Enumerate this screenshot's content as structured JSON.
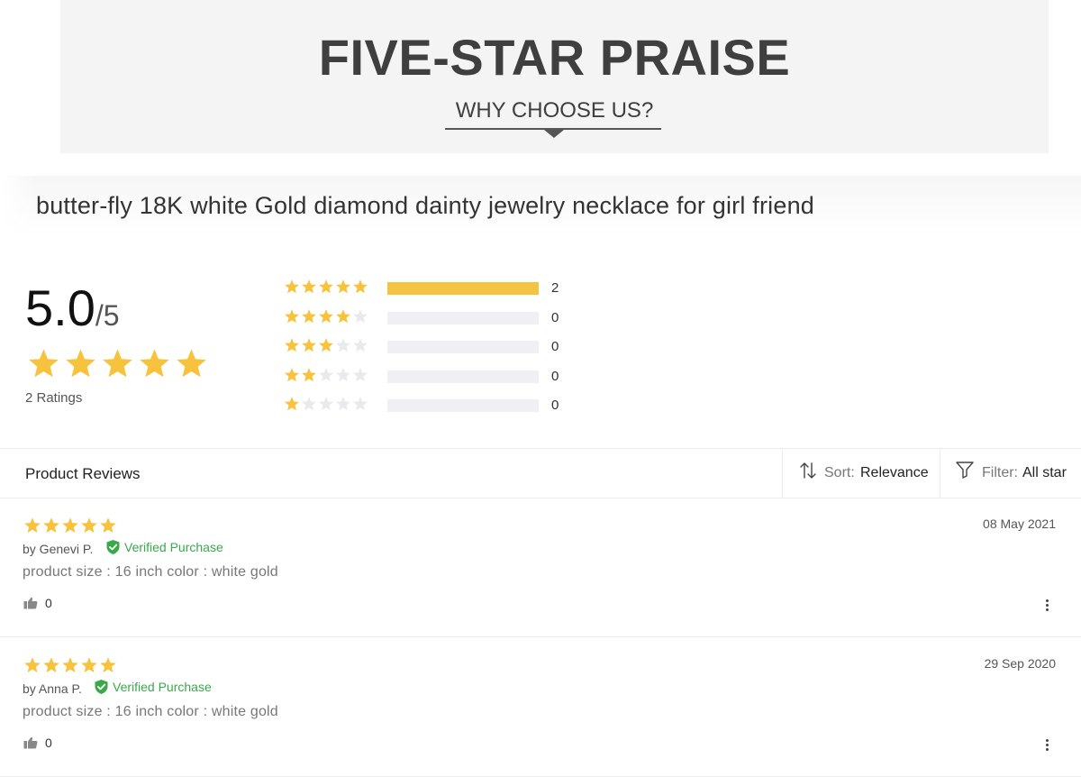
{
  "banner": {
    "title": "FIVE-STAR PRAISE",
    "subtitle": "WHY CHOOSE US?"
  },
  "product": {
    "title": "butter-fly 18K white Gold diamond dainty jewelry necklace for girl friend"
  },
  "summary": {
    "score": "5.0",
    "separator": "/",
    "out_of": "5",
    "stars": 5,
    "ratings_label": "2 Ratings",
    "histogram": [
      {
        "stars": 5,
        "count": "2",
        "fraction": 1.0
      },
      {
        "stars": 4,
        "count": "0",
        "fraction": 0
      },
      {
        "stars": 3,
        "count": "0",
        "fraction": 0
      },
      {
        "stars": 2,
        "count": "0",
        "fraction": 0
      },
      {
        "stars": 1,
        "count": "0",
        "fraction": 0
      }
    ]
  },
  "reviews_header": {
    "title": "Product Reviews",
    "sort_label": "Sort:",
    "sort_value": "Relevance",
    "filter_label": "Filter:",
    "filter_value": "All star"
  },
  "reviews": [
    {
      "stars": 5,
      "author": "by Genevi P.",
      "verified": "Verified Purchase",
      "body": "product size : 16 inch color : white gold",
      "likes": "0",
      "date": "08 May 2021"
    },
    {
      "stars": 5,
      "author": "by Anna P.",
      "verified": "Verified Purchase",
      "body": "product size : 16 inch color : white gold",
      "likes": "0",
      "date": "29 Sep 2020"
    }
  ],
  "colors": {
    "star": "#f7c23c",
    "star_empty": "#e9e9ee",
    "verified": "#3aa84b",
    "bar_fill": "#f5c342",
    "bar_bg": "#efeff4"
  },
  "icons": [
    "star-icon",
    "sort-icon",
    "filter-icon",
    "verified-shield-icon",
    "thumbs-up-icon",
    "more-vertical-icon"
  ]
}
